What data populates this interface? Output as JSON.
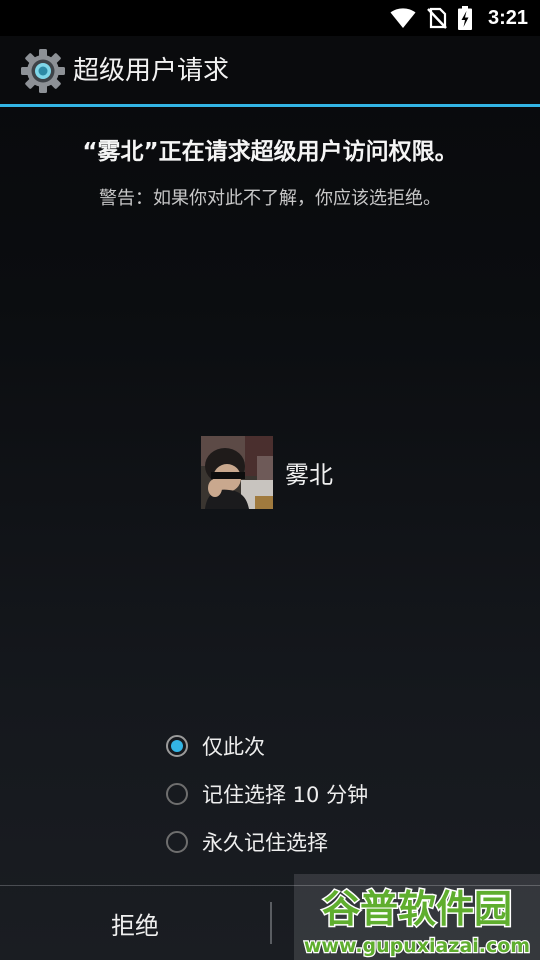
{
  "status_bar": {
    "time": "3:21",
    "icons": [
      "wifi-icon",
      "no-sim-icon",
      "battery-charging-icon"
    ]
  },
  "app_bar": {
    "title": "超级用户请求",
    "icon": "gear-icon"
  },
  "request": {
    "title": "“雾北”正在请求超级用户访问权限。",
    "warning": "警告：如果你对此不了解，你应该选拒绝。"
  },
  "requester": {
    "name": "雾北"
  },
  "options": [
    {
      "label": "仅此次",
      "checked": true
    },
    {
      "label": "记住选择 10 分钟",
      "checked": false
    },
    {
      "label": "永久记住选择",
      "checked": false
    }
  ],
  "buttons": {
    "deny": "拒绝"
  },
  "watermark": {
    "name": "谷普软件园",
    "url": "www.gupuxiazai.com"
  },
  "colors": {
    "accent": "#33b5e5",
    "watermark_green": "#5fae2e"
  }
}
